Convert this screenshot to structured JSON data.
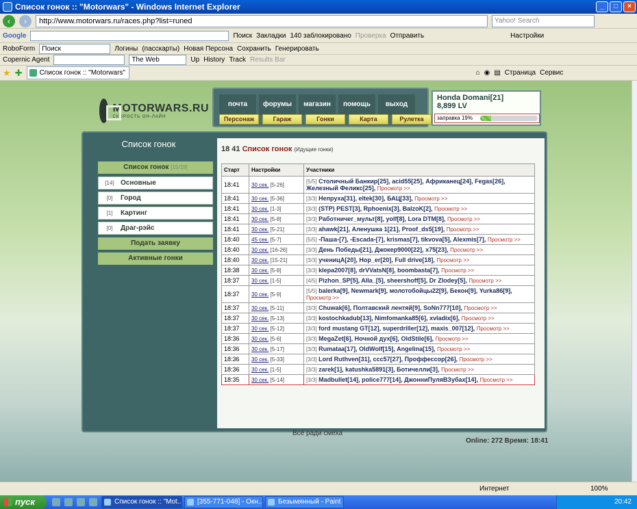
{
  "window": {
    "title": "Список гонок :: \"Motorwars\" - Windows Internet Explorer"
  },
  "address": {
    "url": "http://www.motorwars.ru/races.php?list=runed",
    "search_placeholder": "Yahoo! Search"
  },
  "google_bar": {
    "brand": "Google",
    "search_label": "Поиск",
    "bookmarks": "Закладки",
    "blocked": "140 заблокировано",
    "check": "Проверка",
    "send": "Отправить",
    "settings": "Настройки"
  },
  "roboform_bar": {
    "brand": "RoboForm",
    "search": "Поиск",
    "logins": "Логины",
    "passcards": "(пасскарты)",
    "new_person": "Новая Персона",
    "save": "Сохранить",
    "generate": "Генерировать"
  },
  "copernic_bar": {
    "brand": "Copernic Agent",
    "web": "The Web",
    "up": "Up",
    "history": "History",
    "track": "Track",
    "results": "Results Bar"
  },
  "tab_bar": {
    "tab_title": "Список гонок :: \"Motorwars\"",
    "page": "Страница",
    "service": "Сервис"
  },
  "logo": {
    "name": "MOTORWARS.RU",
    "tagline": "СКОРОСТЬ ОН-ЛАЙН"
  },
  "menu": {
    "top": [
      "почта",
      "форумы",
      "магазин",
      "помощь",
      "выход"
    ],
    "bottom": [
      "Персонаж",
      "Гараж",
      "Гонки",
      "Карта",
      "Рулетка"
    ]
  },
  "user": {
    "name": "Honda Domani[21]",
    "lv": "8,899 LV",
    "fuel_label": "заправка 19%",
    "fuel_level": 0.19
  },
  "left": {
    "title": "Список гонок",
    "header": {
      "label": "Список гонок",
      "count": "[15/19]"
    },
    "items": [
      {
        "count": "[14]",
        "label": "Основные"
      },
      {
        "count": "[0]",
        "label": "Город"
      },
      {
        "count": "[1]",
        "label": "Картинг"
      },
      {
        "count": "[0]",
        "label": "Драг-рэйс"
      }
    ],
    "buttons": [
      "Подать заявку",
      "Активные гонки"
    ]
  },
  "races_title": {
    "time": "18 41",
    "title": "Список гонок",
    "sub": "(Идущие гонки)"
  },
  "table": {
    "headers": [
      "Старт",
      "Настройки",
      "Участники"
    ],
    "rows": [
      {
        "time": "18:41",
        "dur": "30 сек.",
        "range": "[5-26]",
        "count": "[5/5]",
        "names": "Столичный Банкир[25], acid55[25], Африканец[24], Fegas[26], Железный Феликс[25],"
      },
      {
        "time": "18:41",
        "dur": "30 сек.",
        "range": "[5-36]",
        "count": "[3/3]",
        "names": "Непруха[31], eltek[30], БАЦ[33],"
      },
      {
        "time": "18:41",
        "dur": "30 сек.",
        "range": "[1-3]",
        "count": "[3/3]",
        "names": "(STP) PEST[3], Rphoenix[3], BalzoK[2],"
      },
      {
        "time": "18:41",
        "dur": "30 сек.",
        "range": "[5-8]",
        "count": "[3/3]",
        "names": "Работничег_мульт[8], yolf[8], Lora DTM[8],"
      },
      {
        "time": "18:41",
        "dur": "30 сек.",
        "range": "[5-21]",
        "count": "[3/3]",
        "names": "ahawk[21], Аленушка 1[21], Proof_ds5[19],"
      },
      {
        "time": "18:40",
        "dur": "45 сек.",
        "range": "[5-7]",
        "count": "[5/5]",
        "names": "-Паша-[7], -Escada-[7], krismas[7], tikvova[5], Alexmis[7],"
      },
      {
        "time": "18:40",
        "dur": "30 сек.",
        "range": "[16-26]",
        "count": "[3/3]",
        "names": "День Победы[21], Джокер9000[22], x75[23],"
      },
      {
        "time": "18:40",
        "dur": "30 сек.",
        "range": "[15-21]",
        "count": "[3/3]",
        "names": "ученицА[20], Hop_er[20], Full drive[18],"
      },
      {
        "time": "18:38",
        "dur": "30 сек.",
        "range": "[5-8]",
        "count": "[3/3]",
        "names": "klepa2007[8], drVVatsN[8], boombasta[7],"
      },
      {
        "time": "18:37",
        "dur": "30 сек.",
        "range": "[1-5]",
        "count": "[4/5]",
        "names": "Pizhon_SP[5], Alla_[5], sheershoff[5], Dr Zlodey[5],"
      },
      {
        "time": "18:37",
        "dur": "30 сек.",
        "range": "[5-9]",
        "count": "[5/5]",
        "names": "balerka[9], Newmark[9], молотобойцы22[9], Бекон[9], Yurka86[9],"
      },
      {
        "time": "18:37",
        "dur": "30 сек.",
        "range": "[5-11]",
        "count": "[3/3]",
        "names": "Chuwak[6], Полтавский лентяй[9], SoNn777[10],"
      },
      {
        "time": "18:37",
        "dur": "30 сек.",
        "range": "[5-13]",
        "count": "[3/3]",
        "names": "kostochkadub[13], Nimfomanka85[6], xvladix[6],"
      },
      {
        "time": "18:37",
        "dur": "30 сек.",
        "range": "[5-12]",
        "count": "[3/3]",
        "names": "ford mustang GT[12], superdriller[12], maxis_007[12],"
      },
      {
        "time": "18:36",
        "dur": "30 сек.",
        "range": "[5-6]",
        "count": "[3/3]",
        "names": "MegaZet[6], Ночной дух[6], OldStile[6],"
      },
      {
        "time": "18:36",
        "dur": "30 сек.",
        "range": "[5-17]",
        "count": "[3/3]",
        "names": "Rumataa[17], OldWolf[15], Angelina[15],"
      },
      {
        "time": "18:36",
        "dur": "30 сек.",
        "range": "[5-33]",
        "count": "[3/3]",
        "names": "Lord Ruthven[31], ccc57[27], Проффессор[26],"
      },
      {
        "time": "18:36",
        "dur": "30 сек.",
        "range": "[1-5]",
        "count": "[3/3]",
        "names": "zarek[1], katushka5891[3], Ботичелли[3],"
      },
      {
        "time": "18:35",
        "dur": "30 сек.",
        "range": "[5-14]",
        "count": "[3/3]",
        "names": "Madbullet[14], police777[14], ДжонниПуляВЗубах[14],"
      }
    ],
    "view_label": "Просмотр >>"
  },
  "footer": {
    "note": "Всё ради смеха",
    "online": "Online: 272  Время: 18:41"
  },
  "status": {
    "zone": "Интернет",
    "zoom": "100%"
  },
  "taskbar": {
    "start": "пуск",
    "tasks": [
      "Список гонок :: \"Mot...",
      "[355-771-048] - Окн...",
      "Безымянный - Paint"
    ],
    "clock": "20:42"
  }
}
